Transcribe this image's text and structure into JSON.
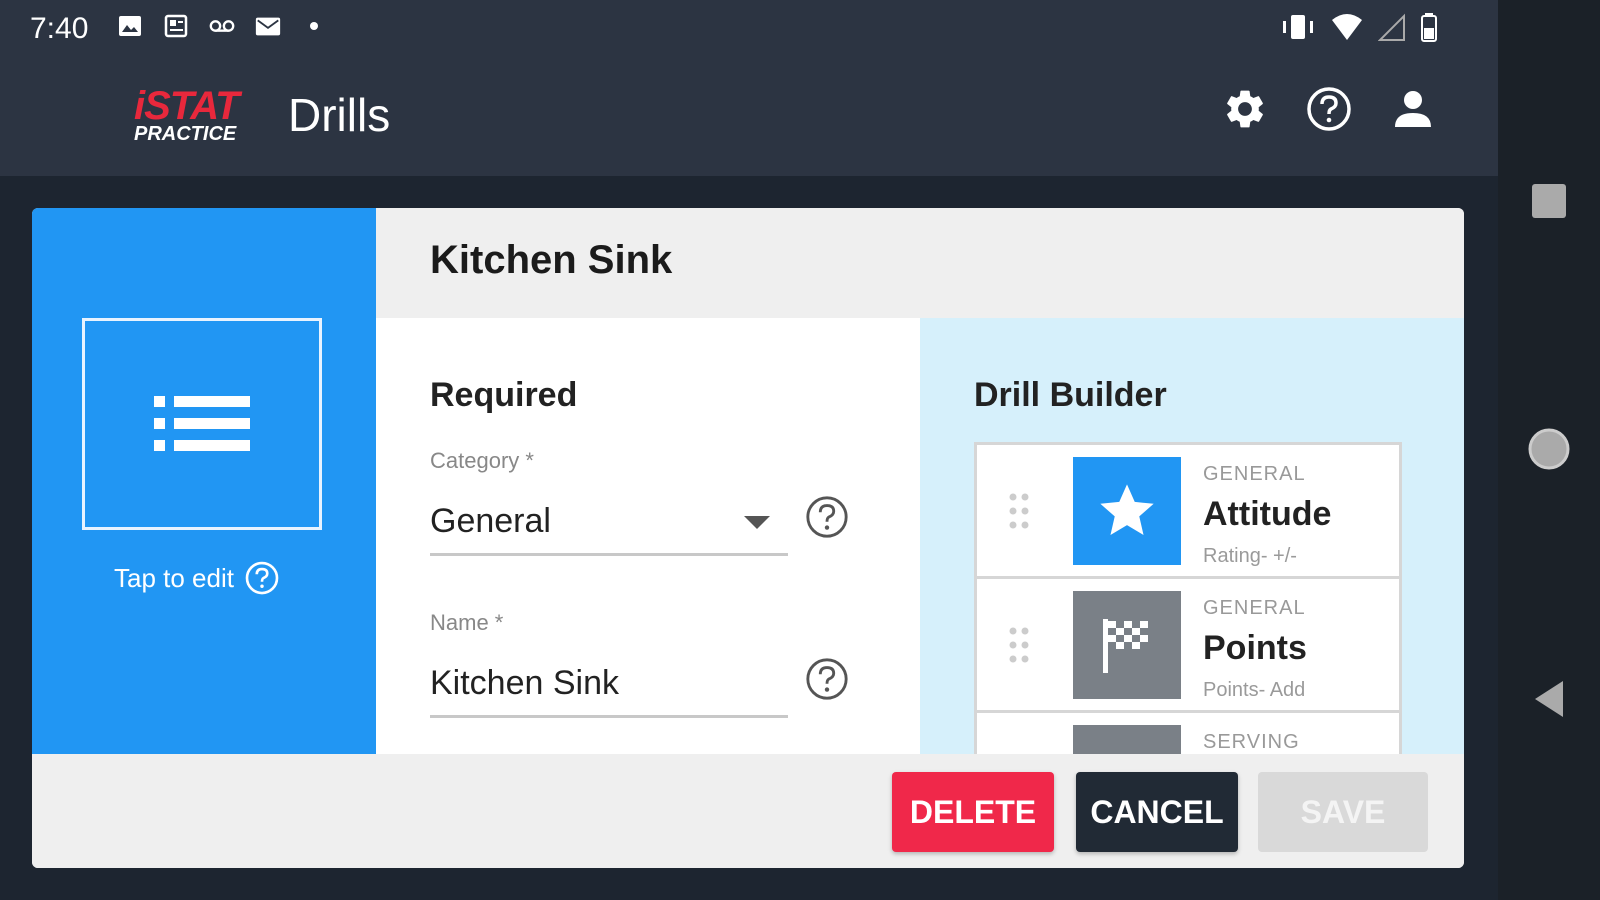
{
  "status_bar": {
    "time": "7:40"
  },
  "app_bar": {
    "logo_top": "iSTAT",
    "logo_bottom": "PRACTICE",
    "title": "Drills"
  },
  "dialog": {
    "title": "Kitchen Sink",
    "tap_to_edit": "Tap to edit",
    "required": {
      "heading": "Required",
      "category_label": "Category *",
      "category_value": "General",
      "name_label": "Name *",
      "name_value": "Kitchen Sink"
    },
    "builder": {
      "heading": "Drill Builder",
      "items": [
        {
          "category": "GENERAL",
          "name": "Attitude",
          "subtitle": "Rating- +/-",
          "icon": "star-icon",
          "color": "#2196f3"
        },
        {
          "category": "GENERAL",
          "name": "Points",
          "subtitle": "Points- Add",
          "icon": "checkered-flag-icon",
          "color": "#7a8087"
        },
        {
          "category": "SERVING",
          "name": "",
          "subtitle": "",
          "icon": "",
          "color": "#7a8087"
        }
      ]
    },
    "buttons": {
      "delete": "DELETE",
      "cancel": "CANCEL",
      "save": "SAVE"
    }
  },
  "colors": {
    "primary": "#2196f3",
    "delete": "#f0284a",
    "cancel": "#212a35",
    "save_disabled": "#d9d9d9",
    "app_bar": "#2c3442",
    "builder_bg": "#d6f0fb"
  }
}
